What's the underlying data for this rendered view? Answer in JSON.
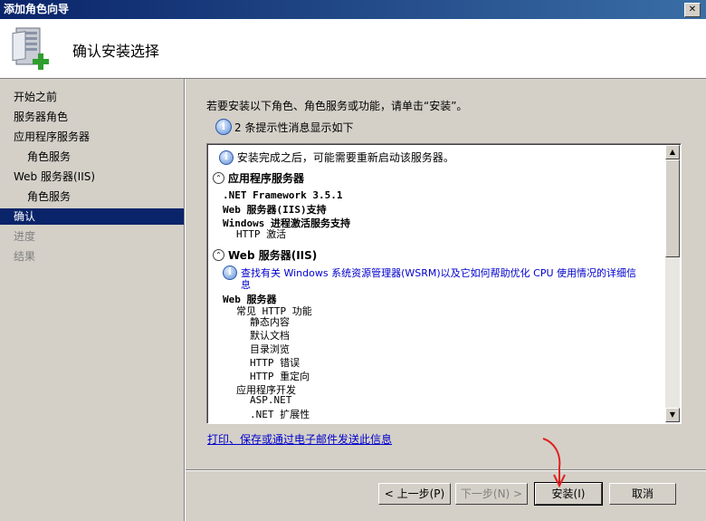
{
  "window": {
    "title": "添加角色向导"
  },
  "header": {
    "title": "确认安装选择"
  },
  "sidebar": {
    "items": [
      {
        "label": "开始之前"
      },
      {
        "label": "服务器角色"
      },
      {
        "label": "应用程序服务器"
      },
      {
        "label": "角色服务"
      },
      {
        "label": "Web 服务器(IIS)"
      },
      {
        "label": "角色服务"
      },
      {
        "label": "确认"
      },
      {
        "label": "进度"
      },
      {
        "label": "结果"
      }
    ]
  },
  "main": {
    "intro": "若要安装以下角色、角色服务或功能，请单击“安装”。",
    "message_count": "2 条提示性消息显示如下",
    "results": {
      "restart_notice": "安装完成之后，可能需要重新启动该服务器。",
      "app_server": {
        "title": "应用程序服务器",
        "lines": [
          ".NET Framework 3.5.1",
          "Web 服务器(IIS)支持",
          "Windows 进程激活服务支持",
          "HTTP 激活"
        ]
      },
      "web_server": {
        "title": "Web 服务器(IIS)",
        "info_link_line1": "查找有关 Windows 系统资源管理器(WSRM)以及它如何帮助优化 CPU 使用情况的详细信",
        "info_link_line2": "息",
        "lines": [
          "Web 服务器",
          "常见 HTTP 功能",
          "静态内容",
          "默认文档",
          "目录浏览",
          "HTTP 错误",
          "HTTP 重定向",
          "应用程序开发",
          "ASP.NET",
          ".NET 扩展性"
        ]
      }
    },
    "print_link": "打印、保存或通过电子邮件发送此信息"
  },
  "buttons": {
    "prev": "< 上一步(P)",
    "next": "下一步(N) >",
    "install": "安装(I)",
    "cancel": "取消"
  },
  "icons": {
    "header": "server-add-icon",
    "info": "info-icon",
    "collapse": "collapse-icon"
  }
}
